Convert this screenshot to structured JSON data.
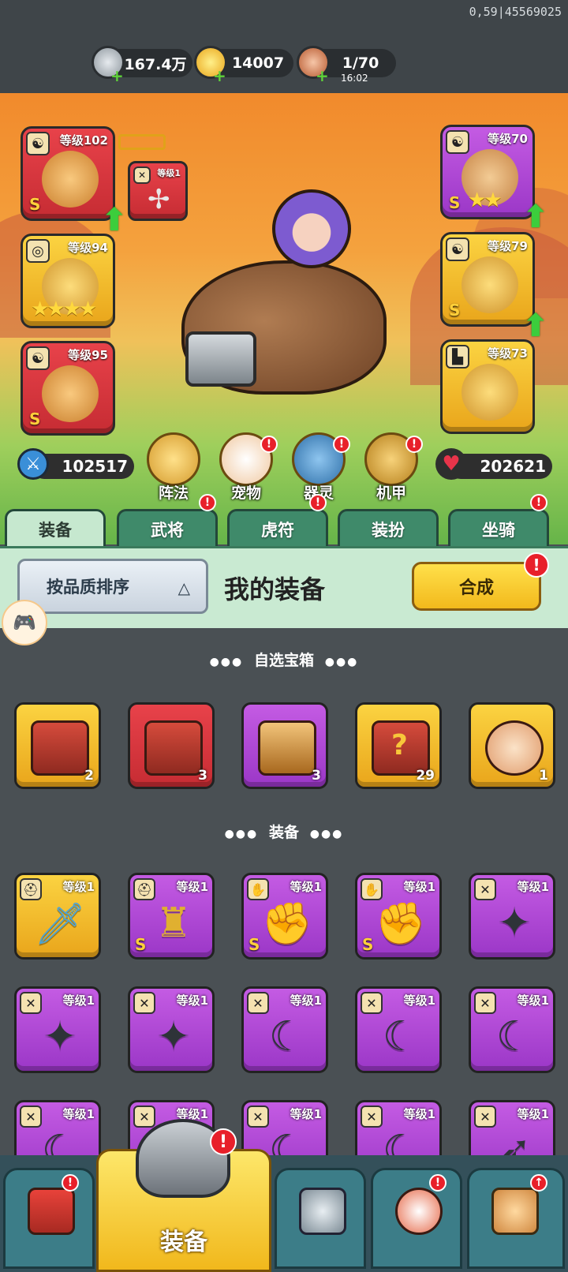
{
  "status": {
    "debug_text": "0,59|45569025"
  },
  "resources": [
    {
      "name": "silver-coin",
      "value": "167.4万"
    },
    {
      "name": "gold-ingot",
      "value": "14007"
    },
    {
      "name": "stamina-meat",
      "value": "1/70",
      "timer": "16:02"
    }
  ],
  "hero": {
    "left_slots": [
      {
        "level": "等级102",
        "quality": "S",
        "tag_icon": "yinyang-icon"
      },
      {
        "level": "等级94",
        "quality": "",
        "stars": "★★★★",
        "tag_icon": "medal-icon"
      },
      {
        "level": "等级95",
        "quality": "S",
        "tag_icon": "yinyang-icon"
      }
    ],
    "right_slots": [
      {
        "level": "等级70",
        "quality": "S",
        "stars": "★★",
        "tag_icon": "yinyang-icon"
      },
      {
        "level": "等级79",
        "quality": "S",
        "tag_icon": "yinyang-icon"
      },
      {
        "level": "等级73",
        "quality": "",
        "tag_icon": "boot-icon"
      }
    ],
    "weapon_slot": {
      "level": "等级1"
    },
    "attack": "102517",
    "hp": "202621",
    "features": [
      {
        "label": "阵法",
        "badge": false
      },
      {
        "label": "宠物",
        "badge": true
      },
      {
        "label": "器灵",
        "badge": true
      },
      {
        "label": "机甲",
        "badge": true
      }
    ]
  },
  "tabs": [
    {
      "label": "装备",
      "active": true,
      "badge": false
    },
    {
      "label": "武将",
      "active": false,
      "badge": true
    },
    {
      "label": "虎符",
      "active": false,
      "badge": true
    },
    {
      "label": "装扮",
      "active": false,
      "badge": false
    },
    {
      "label": "坐骑",
      "active": false,
      "badge": true
    }
  ],
  "sort": {
    "label": "按品质排序"
  },
  "my_equipment_title": "我的装备",
  "synth_button": "合成",
  "sections": {
    "chests": "自选宝箱",
    "equipment": "装备"
  },
  "chests": [
    {
      "color": "yellow",
      "count": "2"
    },
    {
      "color": "red",
      "count": "3"
    },
    {
      "color": "purple",
      "count": "3"
    },
    {
      "color": "yellow",
      "count": "29"
    },
    {
      "color": "yellow",
      "count": "1"
    }
  ],
  "equipment": [
    [
      {
        "color": "yellow",
        "level": "等级1",
        "quality": "",
        "glyph": "sword-icon"
      },
      {
        "color": "purple",
        "level": "等级1",
        "quality": "S",
        "glyph": "armor-icon"
      },
      {
        "color": "purple",
        "level": "等级1",
        "quality": "S",
        "glyph": "gauntlet-icon"
      },
      {
        "color": "purple",
        "level": "等级1",
        "quality": "S",
        "glyph": "gauntlet-icon"
      },
      {
        "color": "purple",
        "level": "等级1",
        "quality": "",
        "glyph": "shuriken-icon"
      }
    ],
    [
      {
        "color": "purple",
        "level": "等级1",
        "quality": "",
        "glyph": "shuriken-icon"
      },
      {
        "color": "purple",
        "level": "等级1",
        "quality": "",
        "glyph": "shuriken-icon"
      },
      {
        "color": "purple",
        "level": "等级1",
        "quality": "",
        "glyph": "scimitar-icon"
      },
      {
        "color": "purple",
        "level": "等级1",
        "quality": "",
        "glyph": "scimitar-icon"
      },
      {
        "color": "purple",
        "level": "等级1",
        "quality": "",
        "glyph": "scimitar-icon"
      }
    ],
    [
      {
        "color": "purple",
        "level": "等级1",
        "quality": "",
        "glyph": "scimitar-icon"
      },
      {
        "color": "purple",
        "level": "等级1",
        "quality": "",
        "glyph": "scimitar-icon"
      },
      {
        "color": "purple",
        "level": "等级1",
        "quality": "",
        "glyph": "scimitar-icon"
      },
      {
        "color": "purple",
        "level": "等级1",
        "quality": "",
        "glyph": "scimitar-icon"
      },
      {
        "color": "purple",
        "level": "等级1",
        "quality": "",
        "glyph": "crossbow-icon"
      }
    ]
  ],
  "bottom_nav": [
    {
      "name": "shop",
      "badge": true
    },
    {
      "name": "equipment",
      "label": "装备",
      "active": true,
      "badge": true
    },
    {
      "name": "arena",
      "badge": false
    },
    {
      "name": "pet",
      "badge": true
    },
    {
      "name": "upgrade",
      "badge": true
    }
  ],
  "colors": {
    "yellow": "#f5c22e",
    "red": "#e0373f",
    "purple": "#b349d8",
    "tab_green": "#3f8a6a",
    "strip_green": "#c9ead2"
  }
}
